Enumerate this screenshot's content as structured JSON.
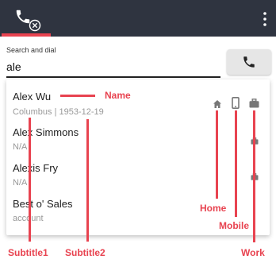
{
  "search": {
    "label": "Search and dial",
    "value": "ale"
  },
  "results": [
    {
      "name": "Alex Wu",
      "subtitle": "Columbus | 1953-12-19",
      "icons": [
        "home-icon",
        "mobile-icon",
        "work-icon"
      ]
    },
    {
      "name": "Alex Simmons",
      "subtitle": "N/A",
      "icons": [
        "work-icon"
      ]
    },
    {
      "name": "Alexis Fry",
      "subtitle": "N/A",
      "icons": [
        "work-icon"
      ]
    },
    {
      "name": "Best o' Sales",
      "subtitle": "account",
      "icons": []
    }
  ],
  "annotations": {
    "name": "Name",
    "home": "Home",
    "mobile": "Mobile",
    "work": "Work",
    "subtitle1": "Subtitle1",
    "subtitle2": "Subtitle2"
  },
  "colors": {
    "header": "#2f3440",
    "accent": "#e84350",
    "icon": "#777777"
  }
}
